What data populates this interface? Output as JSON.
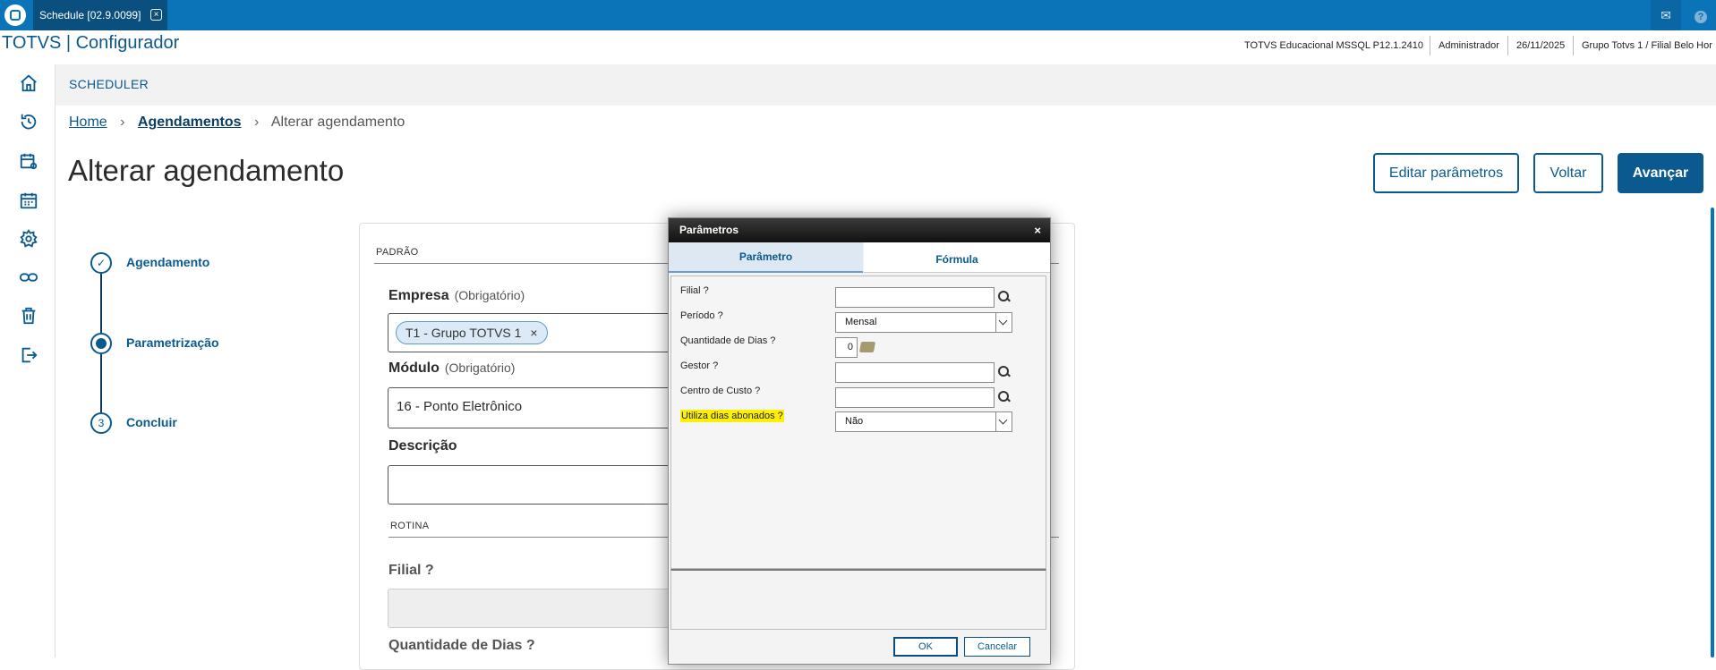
{
  "window": {
    "tab_title": "Schedule [02.9.0099]"
  },
  "app": {
    "title": "TOTVS | Configurador",
    "status": [
      "TOTVS Educacional MSSQL P12.1.2410",
      "Administrador",
      "26/11/2025",
      "Grupo Totvs 1 / Filial Belo Hor"
    ]
  },
  "sidebar": {
    "items": [
      {
        "icon": "home-icon"
      },
      {
        "icon": "history-icon"
      },
      {
        "icon": "calendar-gear-icon"
      },
      {
        "icon": "calendar-icon"
      },
      {
        "icon": "gear-icon"
      },
      {
        "icon": "link-icon"
      },
      {
        "icon": "trash-icon"
      },
      {
        "icon": "logout-icon"
      }
    ]
  },
  "page": {
    "section": "SCHEDULER",
    "breadcrumb": [
      "Home",
      "Agendamentos",
      "Alterar agendamento"
    ],
    "title": "Alterar agendamento",
    "buttons": {
      "edit": "Editar parâmetros",
      "back": "Voltar",
      "next": "Avançar"
    }
  },
  "stepper": {
    "steps": [
      {
        "label": "Agendamento",
        "state": "done"
      },
      {
        "label": "Parametrização",
        "state": "active"
      },
      {
        "label": "Concluir",
        "state": "pending",
        "number": "3"
      }
    ]
  },
  "form": {
    "section_default": "PADRÃO",
    "empresa": {
      "label": "Empresa",
      "hint": "(Obrigatório)",
      "chip": "T1 - Grupo TOTVS 1",
      "chip_remove": "×"
    },
    "modulo": {
      "label": "Módulo",
      "hint": "(Obrigatório)",
      "value": "16 - Ponto Eletrônico"
    },
    "descricao": {
      "label": "Descrição",
      "value": ""
    },
    "section_rotina": "ROTINA",
    "filial_label": "Filial ?",
    "quantidade_label": "Quantidade de Dias ?"
  },
  "dialog": {
    "title": "Parâmetros",
    "close": "×",
    "tabs": [
      "Parâmetro",
      "Fórmula"
    ],
    "params": [
      {
        "label": "Filial ?",
        "type": "search",
        "value": ""
      },
      {
        "label": "Período ?",
        "type": "select",
        "value": "Mensal"
      },
      {
        "label": "Quantidade de Dias ?",
        "type": "number",
        "value": "0"
      },
      {
        "label": "Gestor ?",
        "type": "search",
        "value": ""
      },
      {
        "label": "Centro de Custo ?",
        "type": "search",
        "value": ""
      },
      {
        "label": "Utiliza dias abonados ?",
        "type": "select",
        "value": "Não",
        "highlighted": true
      }
    ],
    "ok": "OK",
    "cancel": "Cancelar"
  }
}
